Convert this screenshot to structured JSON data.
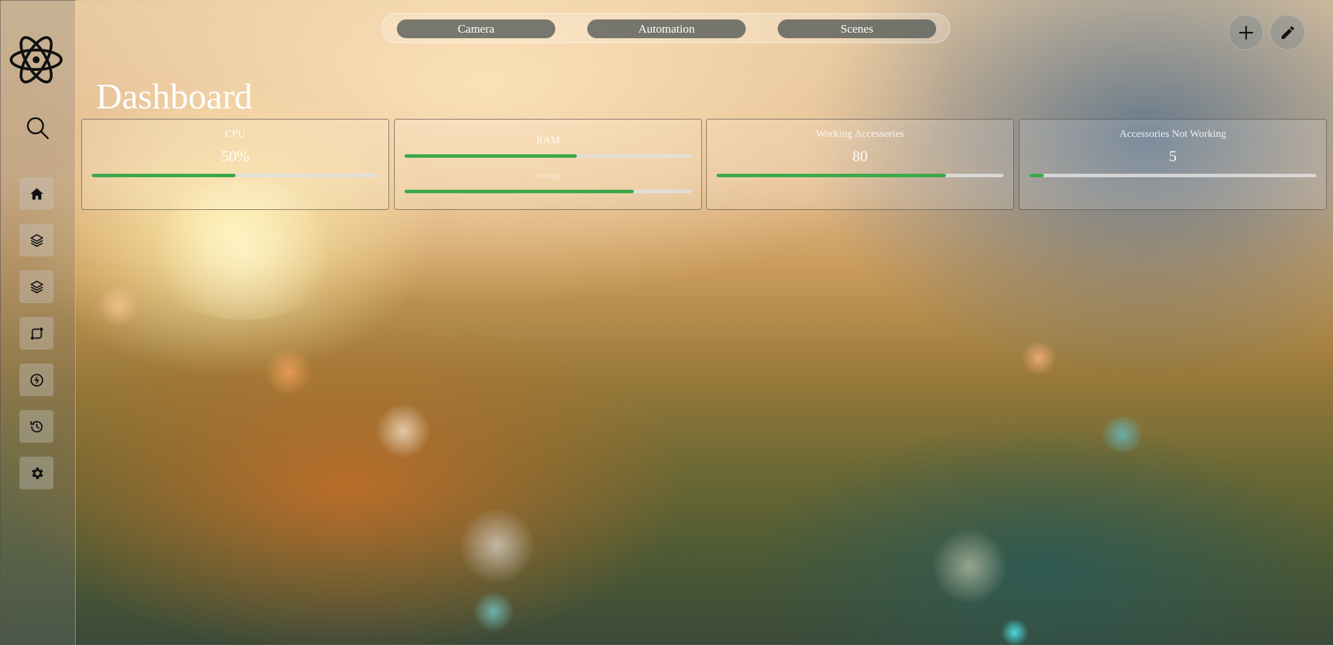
{
  "colors": {
    "accent_green": "#3aa94a",
    "tab_bg": "#5a5f5a",
    "text": "#ffffff"
  },
  "sidebar": {
    "logo_icon": "atom-icon",
    "search_icon": "search-icon",
    "items": [
      {
        "name": "home",
        "icon": "home-icon"
      },
      {
        "name": "layers-1",
        "icon": "layers-icon"
      },
      {
        "name": "layers-2",
        "icon": "layers-icon"
      },
      {
        "name": "routes",
        "icon": "route-icon"
      },
      {
        "name": "energy",
        "icon": "lightning-circle-icon"
      },
      {
        "name": "history",
        "icon": "history-icon"
      },
      {
        "name": "settings",
        "icon": "gear-icon"
      }
    ]
  },
  "topnav": {
    "tabs": [
      {
        "label": "Camera"
      },
      {
        "label": "Automation"
      },
      {
        "label": "Scenes"
      }
    ]
  },
  "actions": {
    "add_icon": "plus-icon",
    "edit_icon": "pencil-icon"
  },
  "page": {
    "title": "Dashboard"
  },
  "cards": {
    "cpu": {
      "label": "CPU",
      "value": "50%",
      "progress": 0.5
    },
    "ram": {
      "label": "RAM",
      "progress": 0.6,
      "storage_label": "Storage",
      "storage_progress": 0.8
    },
    "working": {
      "label": "Working Accessories",
      "value": "80",
      "progress": 0.8
    },
    "not_working": {
      "label": "Accessories Not Working",
      "value": "5",
      "progress": 0.05
    }
  }
}
